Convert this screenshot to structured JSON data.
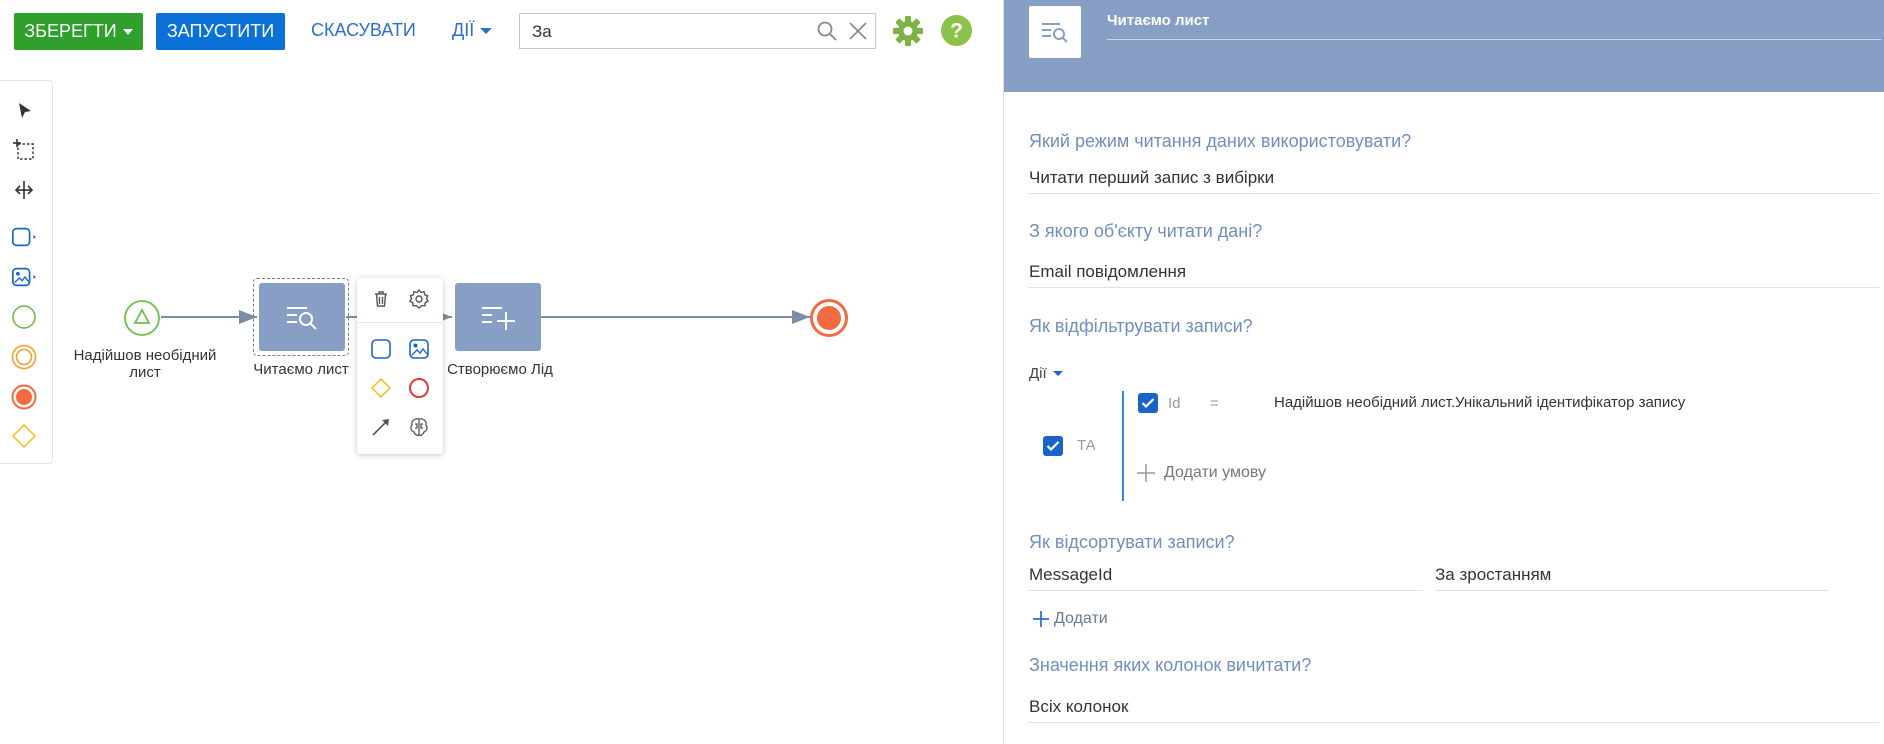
{
  "toolbar": {
    "save_label": "ЗБЕРЕГТИ",
    "run_label": "ЗАПУСТИТИ",
    "cancel_label": "СКАСУВАТИ",
    "actions_label": "ДІЇ",
    "search_value": "За",
    "icons": [
      "search-icon",
      "clear-icon",
      "settings-gear-icon",
      "help-icon"
    ],
    "colors": {
      "save": "#2fa02c",
      "run": "#0b71d9",
      "gear": "#7cb342",
      "help": "#8bc34a"
    }
  },
  "palette": {
    "tools": [
      "pointer-tool",
      "marquee-select-tool",
      "pan-tool",
      "task-tool",
      "subprocess-tool",
      "start-event-tool",
      "intermediate-event-tool",
      "end-event-tool",
      "gateway-tool"
    ]
  },
  "canvas": {
    "nodes": [
      {
        "id": "start",
        "label": "Надійшов необідний лист"
      },
      {
        "id": "read",
        "label": "Читаємо лист"
      },
      {
        "id": "create",
        "label": "Створюємо Лід"
      },
      {
        "id": "end",
        "label": ""
      }
    ],
    "popup_items": [
      "delete-icon",
      "settings-icon",
      "task-icon",
      "subprocess-icon",
      "gateway-icon",
      "end-event-icon",
      "flow-arrow-icon",
      "ai-brain-icon"
    ]
  },
  "panel": {
    "title": "Читаємо лист",
    "read_mode_question": "Який режим читання даних використовувати?",
    "read_mode_value": "Читати перший запис з вибірки",
    "object_question": "З якого об'єкту читати дані?",
    "object_value": "Email повідомлення",
    "filter_question": "Як відфільтрувати записи?",
    "filter_actions": "Дії",
    "filter_group_operator": "ТА",
    "filter_condition": {
      "column": "Id",
      "operator": "=",
      "value": "Надійшов необідний лист.Унікальний ідентифікатор запису"
    },
    "add_condition": "Додати умову",
    "sort_question": "Як відсортувати записи?",
    "sort_column": "MessageId",
    "sort_direction": "За зростанням",
    "add_sort": "Додати",
    "columns_question": "Значення яких колонок вичитати?",
    "columns_value": "Всіх колонок"
  }
}
